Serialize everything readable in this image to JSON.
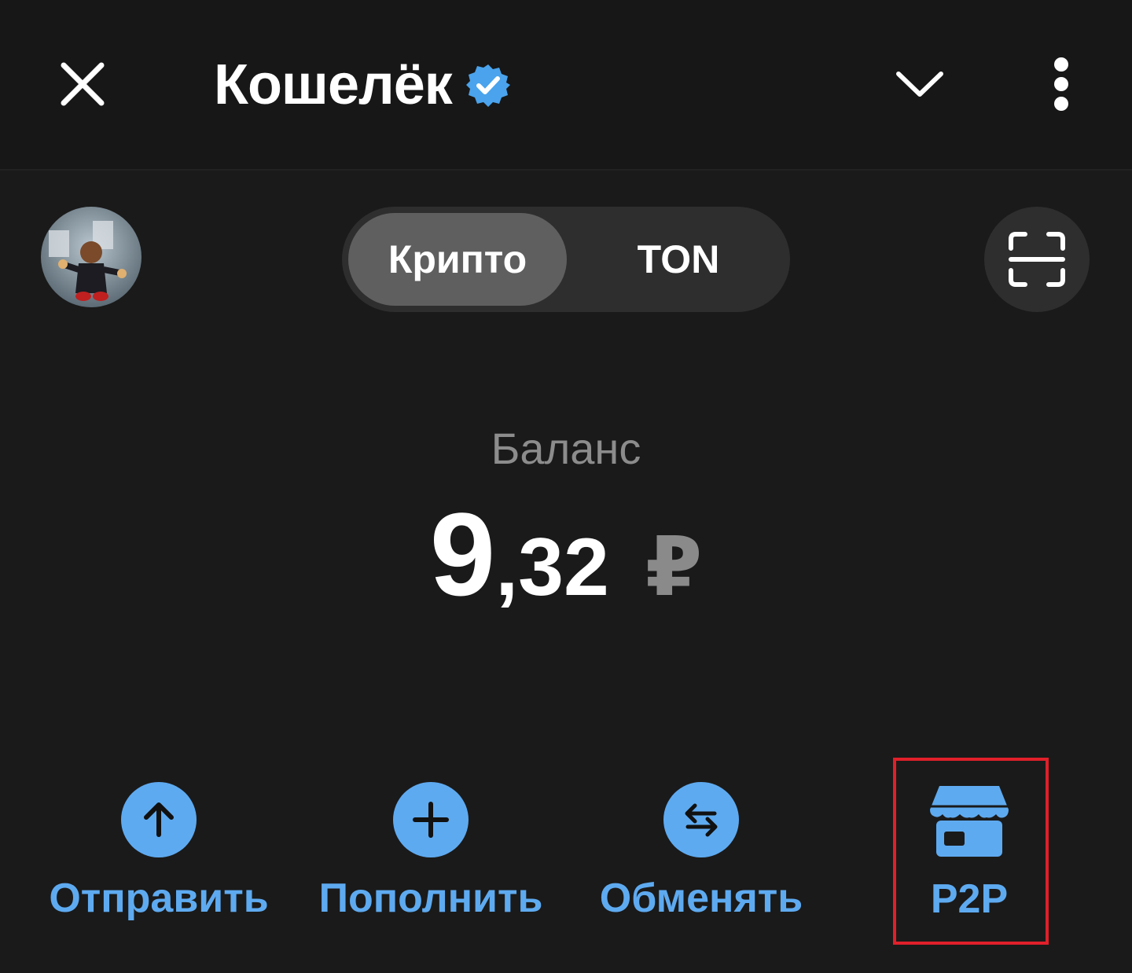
{
  "header": {
    "title": "Кошелёк",
    "close_icon": "close-icon",
    "verified_icon": "verified-badge-icon",
    "chevron_icon": "chevron-down-icon",
    "more_icon": "more-vertical-icon"
  },
  "tabs": {
    "items": [
      {
        "label": "Крипто",
        "active": true
      },
      {
        "label": "TON",
        "active": false
      }
    ]
  },
  "scan": {
    "icon": "scan-icon"
  },
  "balance": {
    "label": "Баланс",
    "integer": "9",
    "fraction": ",32",
    "currency": "₽"
  },
  "actions": [
    {
      "label": "Отправить",
      "icon": "arrow-up-icon"
    },
    {
      "label": "Пополнить",
      "icon": "plus-icon"
    },
    {
      "label": "Обменять",
      "icon": "swap-arrows-icon"
    },
    {
      "label": "P2P",
      "icon": "store-icon"
    }
  ],
  "colors": {
    "background": "#1a1a1a",
    "accent": "#5eaaf0",
    "highlight": "#e0202a"
  }
}
